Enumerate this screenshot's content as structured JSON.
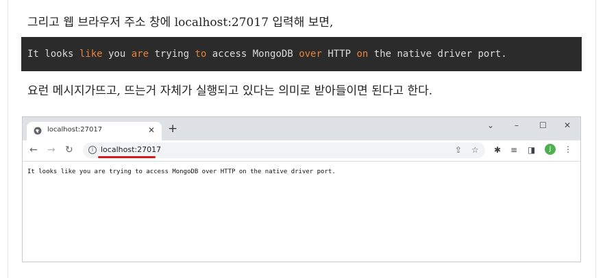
{
  "article": {
    "para1": "그리고 웹 브라우저 주소 창에 localhost:27017 입력해 보면,",
    "para2": "요런 메시지가뜨고, 뜨는거 자체가 실행되고 있다는 의미로 받아들이면 된다고 한다."
  },
  "code": {
    "tokens": [
      "It looks ",
      "like",
      " you ",
      "are",
      " trying ",
      "to",
      " access MongoDB ",
      "over",
      " HTTP ",
      "on",
      " the native driver port."
    ],
    "keyword_color": "#e8823a",
    "background": "#2b2b2b"
  },
  "browser": {
    "tab_title": "localhost:27017",
    "tab_close": "✕",
    "new_tab": "+",
    "window": {
      "chevron": "⌄",
      "minimize": "–",
      "maximize": "☐",
      "close": "✕"
    },
    "nav": {
      "back": "←",
      "forward": "→",
      "reload": "↻"
    },
    "address": "localhost:27017",
    "info": "i",
    "omni": {
      "share": "⇪",
      "star": "☆"
    },
    "toolbar": {
      "extensions": "✱",
      "reading_list": "≡",
      "side_panel": "◨",
      "avatar": "J",
      "menu": "⋮"
    },
    "page_text": "It looks like you are trying to access MongoDB over HTTP on the native driver port.",
    "highlight_color": "#d41a1a"
  }
}
